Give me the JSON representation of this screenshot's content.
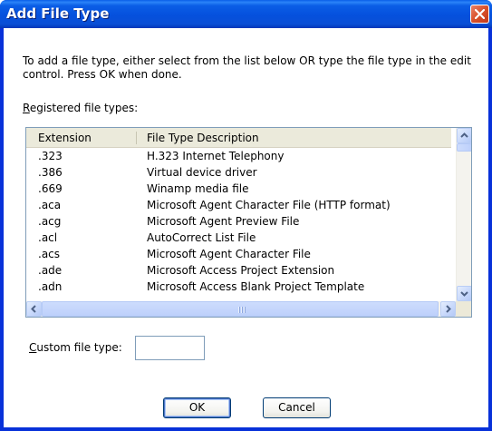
{
  "window": {
    "title": "Add File Type"
  },
  "instructions": "To add a file type, either select from the list below OR type the file type in the edit control. Press OK when done.",
  "registered_label": {
    "accel": "R",
    "rest": "egistered file types:"
  },
  "list": {
    "columns": [
      "Extension",
      "File Type Description"
    ],
    "rows": [
      {
        "ext": ".323",
        "desc": "H.323 Internet Telephony"
      },
      {
        "ext": ".386",
        "desc": "Virtual device driver"
      },
      {
        "ext": ".669",
        "desc": "Winamp media file"
      },
      {
        "ext": ".aca",
        "desc": "Microsoft Agent Character File (HTTP format)"
      },
      {
        "ext": ".acg",
        "desc": "Microsoft Agent Preview File"
      },
      {
        "ext": ".acl",
        "desc": "AutoCorrect List File"
      },
      {
        "ext": ".acs",
        "desc": "Microsoft Agent Character File"
      },
      {
        "ext": ".ade",
        "desc": "Microsoft Access Project Extension"
      },
      {
        "ext": ".adn",
        "desc": "Microsoft Access Blank Project Template"
      }
    ]
  },
  "custom": {
    "accel": "C",
    "rest": "ustom file type:",
    "value": ""
  },
  "buttons": {
    "ok": "OK",
    "cancel": "Cancel"
  },
  "colors": {
    "title_bar": "#0550dd",
    "dialog_bg": "#ffffff",
    "list_border": "#7f9db9",
    "close_red": "#d8502a"
  },
  "icons": [
    "close-icon",
    "scroll-up-arrow-icon",
    "scroll-down-arrow-icon",
    "scroll-left-arrow-icon",
    "scroll-right-arrow-icon"
  ]
}
